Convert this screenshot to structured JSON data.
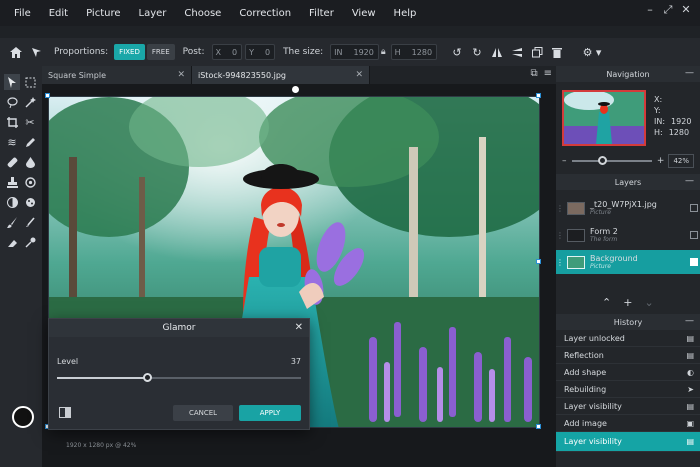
{
  "menu": [
    "File",
    "Edit",
    "Picture",
    "Layer",
    "Choose",
    "Correction",
    "Filter",
    "View",
    "Help"
  ],
  "toolbar": {
    "proportions_label": "Proportions:",
    "fixed_label": "FIXED",
    "free_label": "FREE",
    "post_label": "Post:",
    "post_x_key": "X",
    "post_x_val": "0",
    "post_y_key": "Y",
    "post_y_val": "0",
    "size_label": "The size:",
    "width_key": "IN",
    "width_val": "1920",
    "height_key": "H",
    "height_val": "1280"
  },
  "tabs": [
    {
      "label": "Square Simple"
    },
    {
      "label": "iStock-994823550.jpg"
    }
  ],
  "canvas": {
    "status": "1920 x 1280 px @ 42%"
  },
  "dialog": {
    "title": "Glamor",
    "level_label": "Level",
    "level_value": "37",
    "level_fraction": 0.37,
    "cancel_label": "CANCEL",
    "apply_label": "APPLY"
  },
  "navigation": {
    "title": "Navigation",
    "x_label": "X:",
    "y_label": "Y:",
    "in_label": "IN:",
    "in_value": "1920",
    "h_label": "H:",
    "h_value": "1280",
    "zoom_value": "42%",
    "zoom_fraction": 0.35
  },
  "layers": {
    "title": "Layers",
    "items": [
      {
        "name": "_t20_W7PjX1.jpg",
        "type": "Picture",
        "selected": false
      },
      {
        "name": "Form 2",
        "type": "The form",
        "selected": false
      },
      {
        "name": "Background",
        "type": "Picture",
        "selected": true
      }
    ]
  },
  "history": {
    "title": "History",
    "items": [
      {
        "label": "Layer unlocked",
        "icon": "layers-icon",
        "selected": false
      },
      {
        "label": "Reflection",
        "icon": "layers-icon",
        "selected": false
      },
      {
        "label": "Add shape",
        "icon": "shape-icon",
        "selected": false
      },
      {
        "label": "Rebuilding",
        "icon": "pointer-icon",
        "selected": false
      },
      {
        "label": "Layer visibility",
        "icon": "layers-icon",
        "selected": false
      },
      {
        "label": "Add image",
        "icon": "image-icon",
        "selected": false
      },
      {
        "label": "Layer visibility",
        "icon": "layers-icon",
        "selected": true
      }
    ]
  },
  "colors": {
    "accent": "#1aa7a8",
    "background": "#1f2226"
  }
}
